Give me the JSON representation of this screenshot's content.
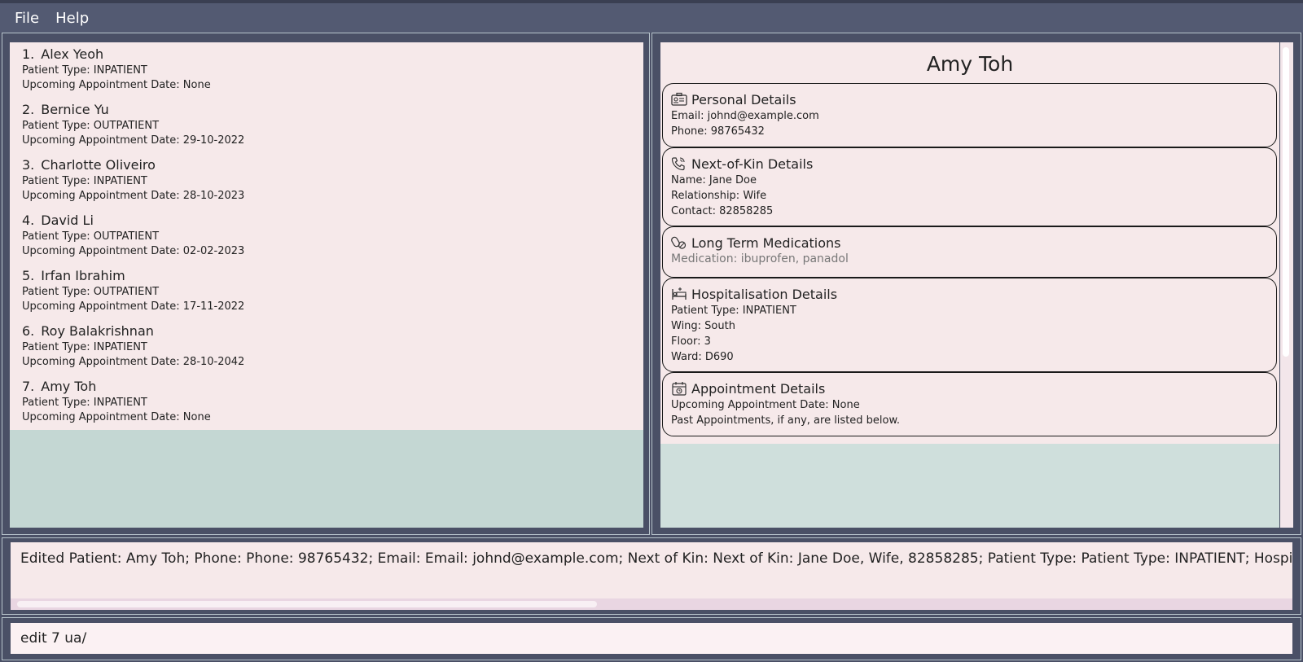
{
  "menu": {
    "file": "File",
    "help": "Help"
  },
  "patients": [
    {
      "index": "1.",
      "name": "Alex Yeoh",
      "type": "Patient Type: INPATIENT",
      "appointment": "Upcoming Appointment Date: None"
    },
    {
      "index": "2.",
      "name": "Bernice Yu",
      "type": "Patient Type: OUTPATIENT",
      "appointment": "Upcoming Appointment Date: 29-10-2022"
    },
    {
      "index": "3.",
      "name": "Charlotte Oliveiro",
      "type": "Patient Type: INPATIENT",
      "appointment": "Upcoming Appointment Date: 28-10-2023"
    },
    {
      "index": "4.",
      "name": "David Li",
      "type": "Patient Type: OUTPATIENT",
      "appointment": "Upcoming Appointment Date: 02-02-2023"
    },
    {
      "index": "5.",
      "name": "Irfan Ibrahim",
      "type": "Patient Type: OUTPATIENT",
      "appointment": "Upcoming Appointment Date: 17-11-2022"
    },
    {
      "index": "6.",
      "name": "Roy Balakrishnan",
      "type": "Patient Type: INPATIENT",
      "appointment": "Upcoming Appointment Date: 28-10-2042"
    },
    {
      "index": "7.",
      "name": "Amy Toh",
      "type": "Patient Type: INPATIENT",
      "appointment": "Upcoming Appointment Date: None"
    }
  ],
  "detail": {
    "name": "Amy Toh",
    "personal": {
      "title": "Personal Details",
      "icon": "id-card-icon",
      "email": "Email: johnd@example.com",
      "phone": "Phone: 98765432"
    },
    "next_of_kin": {
      "title": "Next-of-Kin Details",
      "icon": "phone-icon",
      "name": "Name: Jane Doe",
      "relationship": "Relationship: Wife",
      "contact": "Contact: 82858285"
    },
    "medications": {
      "title": "Long Term Medications",
      "icon": "pills-icon",
      "medication": "Medication: ibuprofen, panadol"
    },
    "hospitalisation": {
      "title": "Hospitalisation Details",
      "icon": "hospital-bed-icon",
      "type": "Patient Type: INPATIENT",
      "wing": "Wing: South",
      "floor": "Floor: 3",
      "ward": "Ward: D690"
    },
    "appointment": {
      "title": "Appointment Details",
      "icon": "calendar-icon",
      "upcoming": "Upcoming Appointment Date: None",
      "past": "Past Appointments, if any, are listed below."
    }
  },
  "result": "Edited Patient: Amy Toh; Phone: Phone: 98765432; Email: Email: johnd@example.com; Next of Kin: Next of Kin: Jane Doe, Wife, 82858285; Patient Type: Patient Type: INPATIENT; Hospital Wing: C",
  "command": {
    "value": "edit 7 ua/"
  }
}
